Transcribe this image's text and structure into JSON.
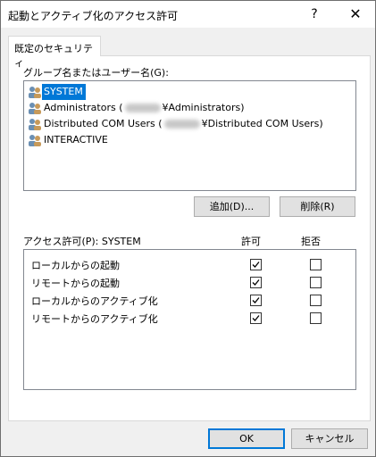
{
  "window": {
    "title": "起動とアクティブ化のアクセス許可",
    "help": "?",
    "close": "✕"
  },
  "tab": {
    "label": "既定のセキュリティ"
  },
  "groups": {
    "label": "グループ名またはユーザー名(G):",
    "items": [
      {
        "text": "SYSTEM",
        "selected": true
      },
      {
        "text_before": "Administrators (",
        "text_after": "¥Administrators)"
      },
      {
        "text_before": "Distributed COM Users (",
        "text_after": "¥Distributed COM Users)"
      },
      {
        "text": "INTERACTIVE"
      }
    ]
  },
  "buttons": {
    "add": "追加(D)...",
    "remove": "削除(R)",
    "ok": "OK",
    "cancel": "キャンセル"
  },
  "permissions": {
    "label": "アクセス許可(P): SYSTEM",
    "allow_header": "許可",
    "deny_header": "拒否",
    "rows": [
      {
        "name": "ローカルからの起動",
        "allow": true,
        "deny": false
      },
      {
        "name": "リモートからの起動",
        "allow": true,
        "deny": false
      },
      {
        "name": "ローカルからのアクティブ化",
        "allow": true,
        "deny": false
      },
      {
        "name": "リモートからのアクティブ化",
        "allow": true,
        "deny": false
      }
    ]
  },
  "colors": {
    "selection": "#0078d7",
    "user_icon_a": "#6a8fb3",
    "user_icon_b": "#c79a5a"
  }
}
